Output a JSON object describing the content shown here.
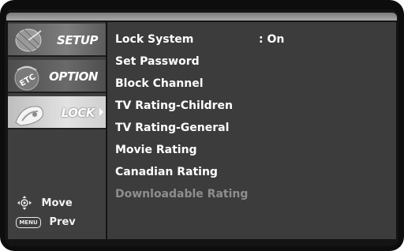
{
  "sidebar": {
    "tabs": [
      {
        "label": "SETUP",
        "icon": "satellite-dish-icon",
        "selected": false
      },
      {
        "label": "OPTION",
        "icon": "etc-icon",
        "selected": false
      },
      {
        "label": "LOCK",
        "icon": "lock-icon",
        "selected": true
      }
    ]
  },
  "help": {
    "move_label": "Move",
    "prev_label": "Prev",
    "menu_key_label": "MENU"
  },
  "menu": {
    "items": [
      {
        "label": "Lock System",
        "value": ": On",
        "enabled": true
      },
      {
        "label": "Set Password",
        "enabled": true
      },
      {
        "label": "Block Channel",
        "enabled": true
      },
      {
        "label": "TV Rating-Children",
        "enabled": true
      },
      {
        "label": "TV Rating-General",
        "enabled": true
      },
      {
        "label": "Movie Rating",
        "enabled": true
      },
      {
        "label": "Canadian Rating",
        "enabled": true
      },
      {
        "label": "Downloadable Rating",
        "enabled": false
      }
    ]
  },
  "colors": {
    "frame": "#0d0d0d",
    "panel": "#3c3c3c",
    "selected_tab": "#d5d5d5",
    "text": "#ffffff",
    "disabled_text": "#8e8e8e"
  }
}
